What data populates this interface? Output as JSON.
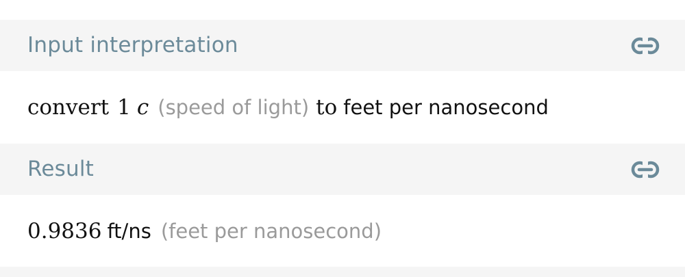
{
  "pods": [
    {
      "title": "Input interpretation",
      "link_icon": "link-icon",
      "content": {
        "convert": "convert",
        "number": "1",
        "symbol": "c",
        "qualifier": "(speed of light)",
        "to": "to",
        "target": "feet per nanosecond"
      }
    },
    {
      "title": "Result",
      "link_icon": "link-icon",
      "content": {
        "value": "0.9836",
        "unit": "ft/ns",
        "unit_description": "(feet per nanosecond)"
      }
    }
  ],
  "colors": {
    "header_bg": "#f5f5f5",
    "header_text": "#6b8a99",
    "icon": "#6b8a99",
    "secondary_text": "#9a9a9a",
    "primary_text": "#111111"
  }
}
